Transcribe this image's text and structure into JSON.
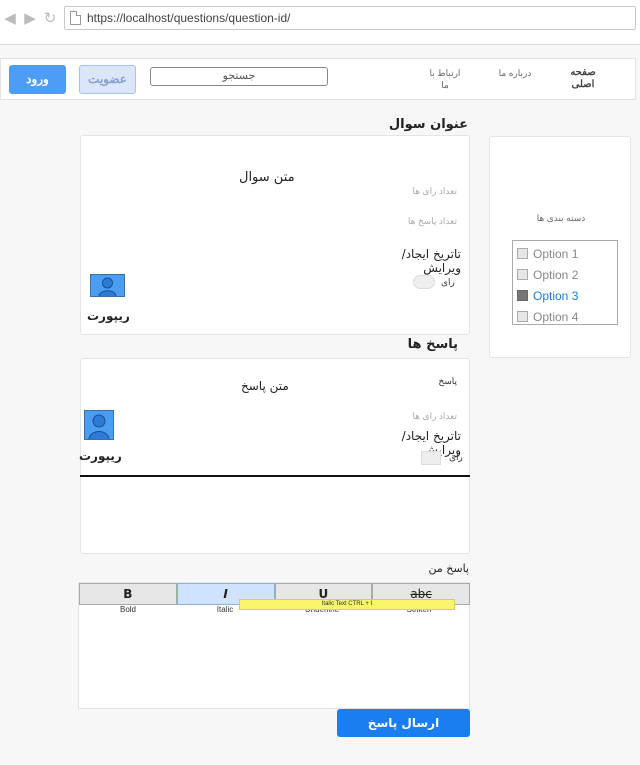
{
  "browser": {
    "url": "https://localhost/questions/question-id/"
  },
  "nav": {
    "home": "صفحه اصلی",
    "about": "درباره ما",
    "contact": "ارتباط با ما",
    "search_placeholder": "جستجو",
    "signup": "عضویت",
    "login": "ورود"
  },
  "sidebar": {
    "title": "دسته بندی ها",
    "options": [
      {
        "label": "Option 1",
        "checked": false
      },
      {
        "label": "Option 2",
        "checked": false
      },
      {
        "label": "Option 3",
        "checked": true
      },
      {
        "label": "Option 4",
        "checked": false
      }
    ]
  },
  "question": {
    "section_title": "عنوان سوال",
    "text": "متن سوال",
    "votes_count_label": "تعداد رای ها",
    "answers_count_label": "تعداد پاسخ ها",
    "date_label": "تاتریخ ایجاد/ویرایش",
    "vote_label": "رای",
    "report_label": "ریپورت"
  },
  "answers": {
    "section_title": "پاسخ ها",
    "author_label": "پاسخ",
    "text": "متن پاسخ",
    "votes_count_label": "تعداد رای ها",
    "date_label": "تاتریخ ایجاد/ویرایش",
    "vote_label": "رای",
    "report_label": "ریپورت"
  },
  "my_answer": {
    "title": "پاسخ من",
    "toolbar": [
      {
        "glyph": "B",
        "label": "Bold"
      },
      {
        "glyph": "I",
        "label": "Italic"
      },
      {
        "glyph": "U",
        "label": "Underline"
      },
      {
        "glyph": "abc",
        "label": "Striken"
      }
    ],
    "tooltip": "Italic Text CTRL + I",
    "submit": "ارسال پاسخ"
  }
}
